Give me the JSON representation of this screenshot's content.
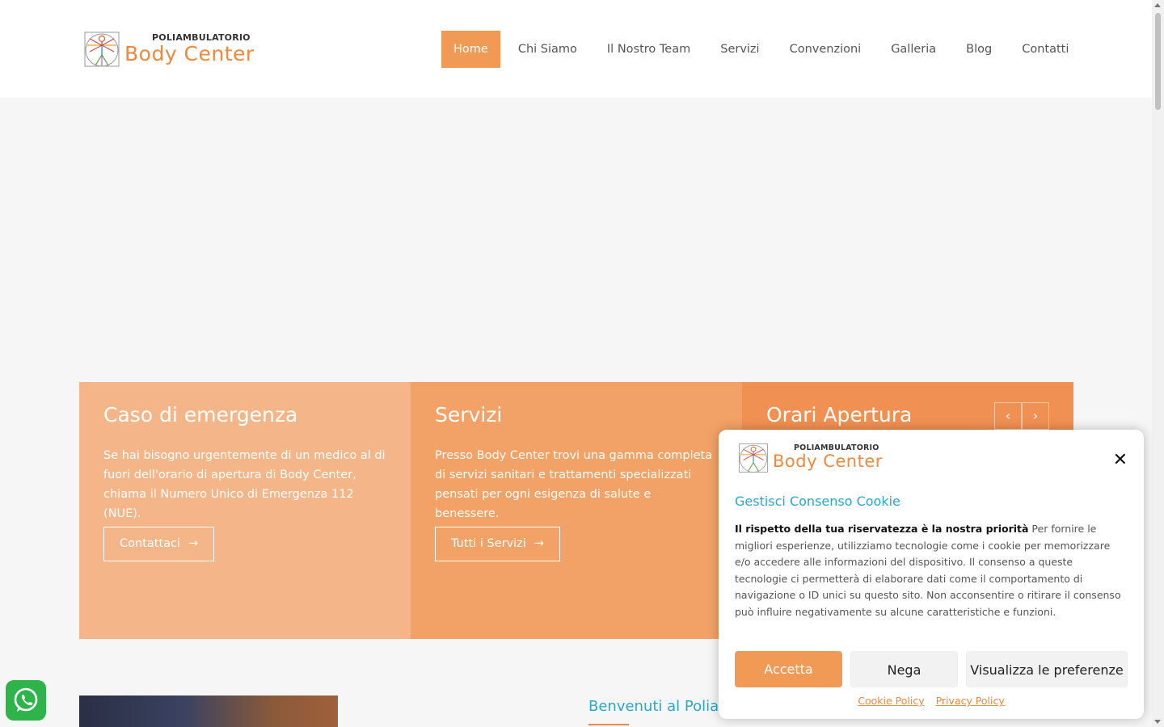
{
  "brand": {
    "top": "POLIAMBULATORIO",
    "main": "Body Center",
    "accent": "#f0883e"
  },
  "nav": {
    "items": [
      {
        "label": "Home",
        "active": true
      },
      {
        "label": "Chi Siamo"
      },
      {
        "label": "Il Nostro Team"
      },
      {
        "label": "Servizi"
      },
      {
        "label": "Convenzioni"
      },
      {
        "label": "Galleria"
      },
      {
        "label": "Blog"
      },
      {
        "label": "Contatti"
      }
    ]
  },
  "features": {
    "emergency": {
      "title": "Caso di emergenza",
      "text": "Se hai bisogno urgentemente di un medico al di fuori dell'orario di apertura di Body Center, chiama il Numero Unico di Emergenza 112 (NUE).",
      "button": "Contattaci"
    },
    "services": {
      "title": "Servizi",
      "text": "Presso Body Center trovi una gamma completa di servizi sanitari e trattamenti specializzati pensati per ogni esigenza di salute e benessere.",
      "button": "Tutti i Servizi"
    },
    "hours": {
      "title": "Orari Apertura",
      "prev": "‹",
      "next": "›"
    }
  },
  "welcome": {
    "title": "Benvenuti al Poliambulatorio"
  },
  "cookie": {
    "title": "Gestisci Consenso Cookie",
    "lead": "Il rispetto della tua riservatezza è la nostra priorità",
    "text": " Per fornire le migliori esperienze, utilizziamo tecnologie come i cookie per memorizzare e/o accedere alle informazioni del dispositivo. Il consenso a queste tecnologie ci permetterà di elaborare dati come il comportamento di navigazione o ID unici su questo sito. Non acconsentire o ritirare il consenso può influire negativamente su alcune caratteristiche e funzioni.",
    "accept": "Accetta",
    "deny": "Nega",
    "prefs": "Visualizza le preferenze",
    "cookie_policy": "Cookie Policy",
    "privacy_policy": "Privacy Policy",
    "close": "✕"
  }
}
